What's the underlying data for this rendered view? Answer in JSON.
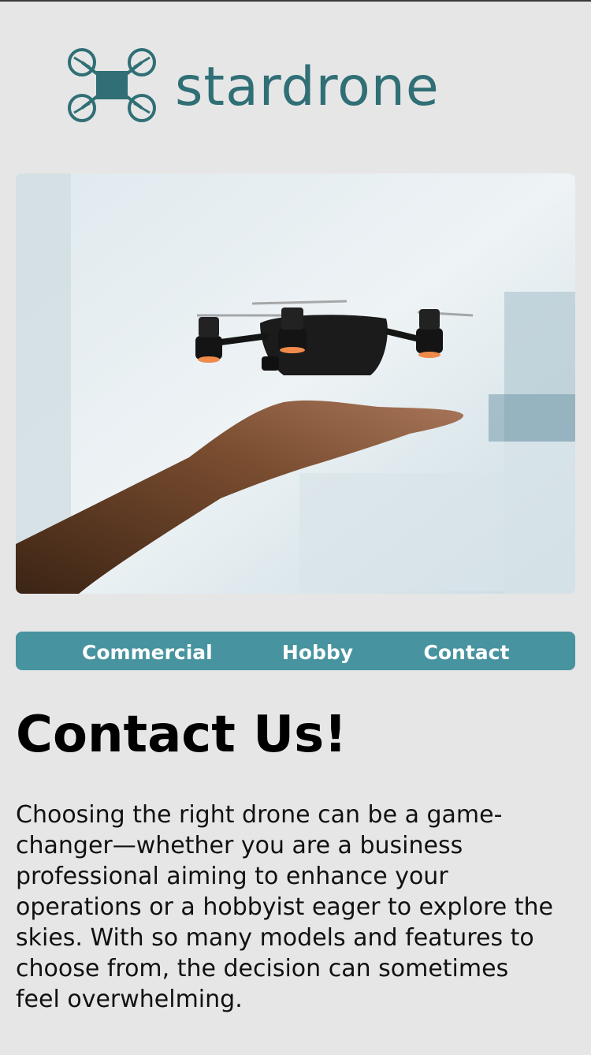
{
  "brand": {
    "name": "stardrone",
    "color": "#2f6f75"
  },
  "hero": {
    "image_description": "hand with drone hovering above open palm"
  },
  "nav": {
    "background": "#4793a0",
    "items": [
      {
        "label": "Commercial"
      },
      {
        "label": "Hobby"
      },
      {
        "label": "Contact"
      }
    ]
  },
  "page": {
    "title": "Contact Us!",
    "body": "Choosing the right drone can be a game-changer—whether you are a business professional aiming to enhance your operations or a hobbyist eager to explore the skies. With so many models and features to choose from, the decision can sometimes feel overwhelming."
  }
}
